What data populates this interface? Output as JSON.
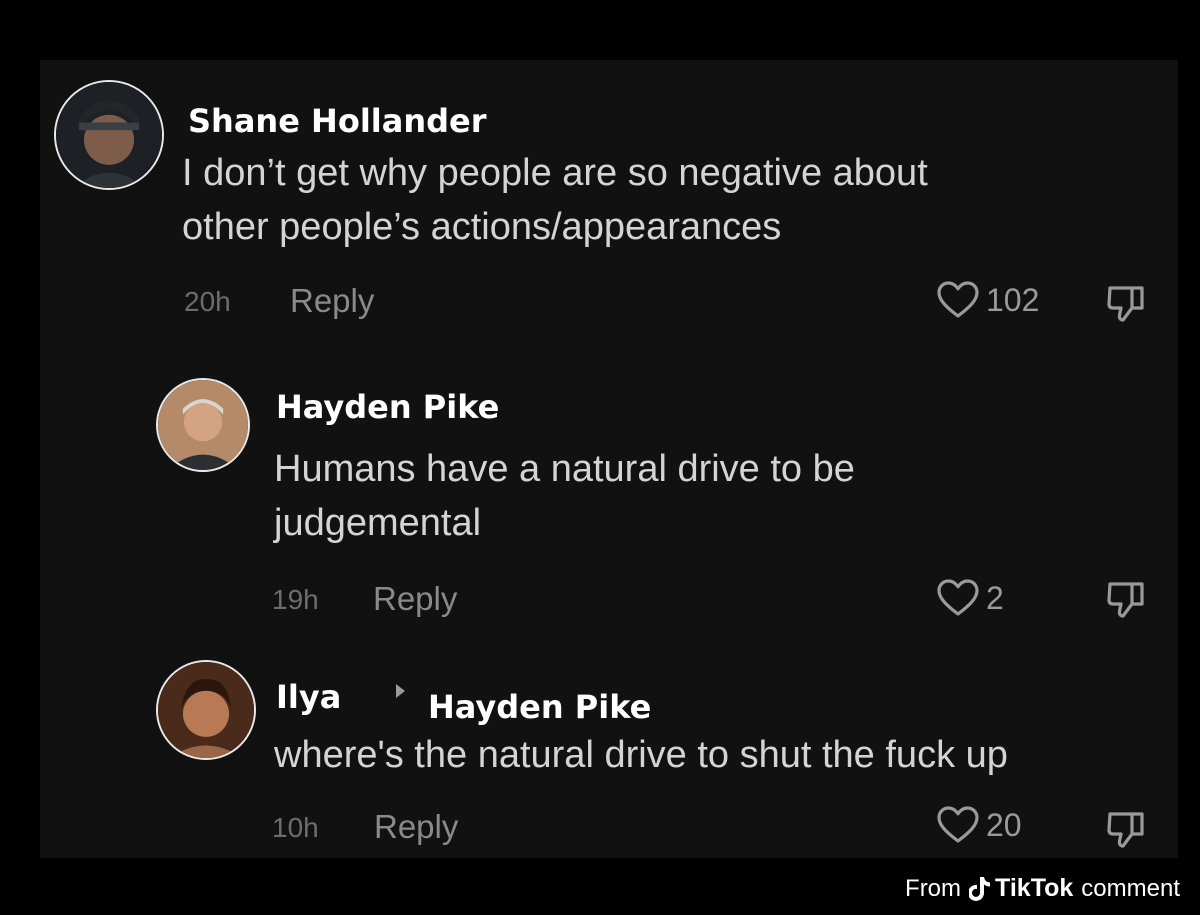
{
  "comments": [
    {
      "username": "Shane Hollander",
      "text_lines": [
        "I don’t get why people are so negative about",
        "other people’s actions/appearances"
      ],
      "time": "20h",
      "reply_label": "Reply",
      "likes": "102"
    },
    {
      "username": "Hayden Pike",
      "text_lines": [
        "Humans have a natural drive to be",
        "judgemental"
      ],
      "time": "19h",
      "reply_label": "Reply",
      "likes": "2"
    },
    {
      "username": "Ilya",
      "reply_to": "Hayden Pike",
      "text_lines": [
        "where's the natural drive to shut the fuck up"
      ],
      "time": "10h",
      "reply_label": "Reply",
      "likes": "20"
    }
  ],
  "footer": {
    "prefix": "From",
    "brand": "TikTok",
    "suffix": "comment"
  },
  "colors": {
    "background": "#000000",
    "panel": "#111111",
    "username": "#ffffff",
    "text": "#d4d4d4",
    "muted": "#8a8a8a"
  },
  "icons": {
    "like": "heart-outline-icon",
    "dislike": "thumbs-down-outline-icon",
    "reply_indicator": "triangle-right-icon",
    "brand": "tiktok-logo-icon"
  }
}
